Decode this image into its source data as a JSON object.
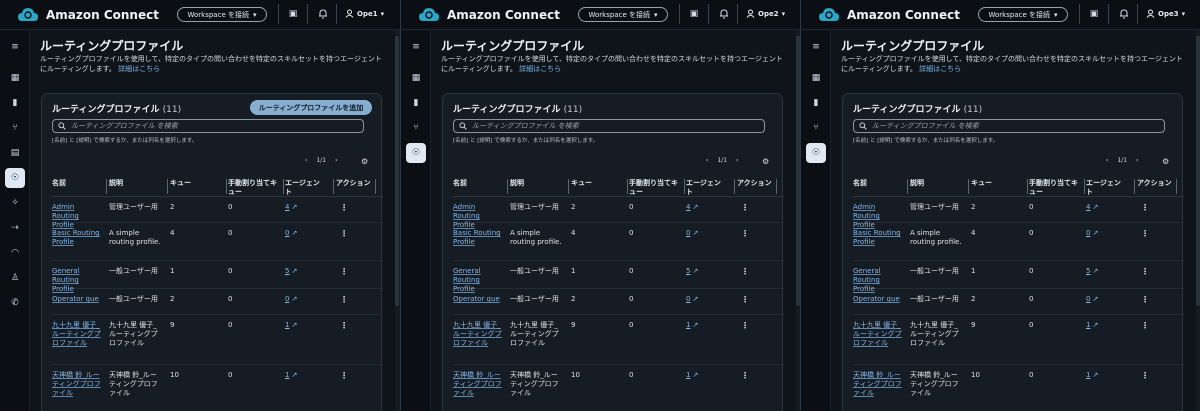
{
  "app": {
    "name": "Amazon Connect",
    "workspace_button": "Workspace を接続"
  },
  "users": [
    "Ope1",
    "Ope2",
    "Ope3"
  ],
  "active_rail_item": [
    7,
    3,
    3
  ],
  "show_add_button": [
    true,
    false,
    false
  ],
  "page": {
    "title": "ルーティングプロファイル",
    "description": "ルーティングプロファイルを使用して、特定のタイプの問い合わせを特定のスキルセットを持つエージェントにルーティングします。",
    "details_link": "詳細はこちら"
  },
  "card": {
    "title": "ルーティングプロファイル",
    "count": "(11)",
    "add_button": "ルーティングプロファイルを追加",
    "search_placeholder": "ルーティングプロファイル を検索",
    "search_hint": "[名前] と [説明] で検索するか、または列名を選択します。",
    "page_indicator": "1/1"
  },
  "columns": [
    "名前",
    "説明",
    "キュー",
    "手動割り当てキュー",
    "エージェント",
    "アクション"
  ],
  "rows": [
    {
      "name": "Admin Routing Profile",
      "description": "管理ユーザー用",
      "queues": "2",
      "manual": "0",
      "agents": "4"
    },
    {
      "name": "Basic Routing Profile",
      "description": "A simple routing profile.",
      "queues": "4",
      "manual": "0",
      "agents": "0"
    },
    {
      "name": "General Routing Profile",
      "description": "一般ユーザー用",
      "queues": "1",
      "manual": "0",
      "agents": "5"
    },
    {
      "name": "Operator que",
      "description": "一般ユーザー用",
      "queues": "2",
      "manual": "0",
      "agents": "0"
    },
    {
      "name": "九十九里 優子_ルーティングプロファイル",
      "description": "九十九里 優子_ルーティングプロファイル",
      "queues": "9",
      "manual": "0",
      "agents": "1"
    },
    {
      "name": "天神橋 鈴_ルーティングプロファイル",
      "description": "天神橋 鈴_ルーティングプロファイル",
      "queues": "10",
      "manual": "0",
      "agents": "1"
    }
  ],
  "icons": {
    "logo": "cloud-headset-icon",
    "workspace_caret": "caret-down-icon",
    "panel": "panel-icon",
    "notification": "bell-icon",
    "user": "user-icon",
    "external": "external-link-icon",
    "actions": "kebab-menu-icon"
  },
  "colors": {
    "accent": "#87aed0",
    "link": "#86b6e6",
    "background": "#0f141a",
    "active_nav": "#dfe8f3"
  }
}
